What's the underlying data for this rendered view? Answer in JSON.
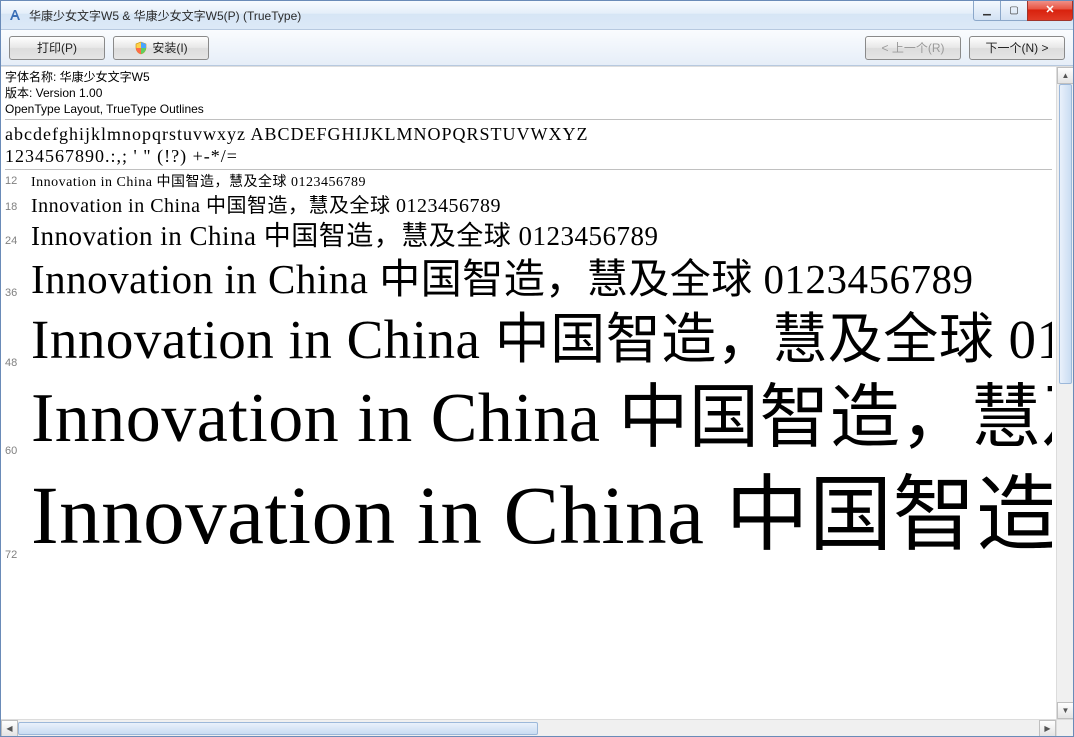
{
  "window": {
    "title": "华康少女文字W5 & 华康少女文字W5(P)  (TrueType)"
  },
  "toolbar": {
    "print_label": "打印(P)",
    "install_label": "安装(I)",
    "prev_label": "< 上一个(R)",
    "next_label": "下一个(N) >"
  },
  "info": {
    "font_name_label": "字体名称: 华康少女文字W5",
    "version_label": "版本: Version 1.00",
    "layout_label": "OpenType Layout, TrueType Outlines"
  },
  "glyph_lines": {
    "lower_upper": "abcdefghijklmnopqrstuvwxyz  ABCDEFGHIJKLMNOPQRSTUVWXYZ",
    "digits_sym": "1234567890.:,;  '  \"  (!?)  +-*/="
  },
  "sample_text": "Innovation in China 中国智造，慧及全球 0123456789",
  "samples": [
    {
      "size": "12",
      "cls": "sz12"
    },
    {
      "size": "18",
      "cls": "sz18"
    },
    {
      "size": "24",
      "cls": "sz24"
    },
    {
      "size": "36",
      "cls": "sz36"
    },
    {
      "size": "48",
      "cls": "sz48"
    },
    {
      "size": "60",
      "cls": "sz60"
    },
    {
      "size": "72",
      "cls": "sz72"
    }
  ]
}
